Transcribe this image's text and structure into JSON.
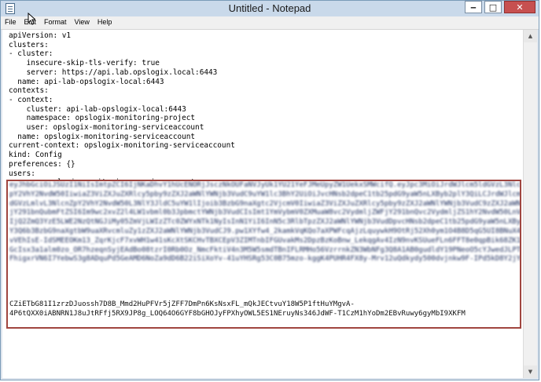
{
  "window": {
    "title": "Untitled - Notepad"
  },
  "controls": {
    "minimize": "‒",
    "maximize": "□",
    "close": "✕"
  },
  "menu": [
    "File",
    "Edit",
    "Format",
    "View",
    "Help"
  ],
  "editor": {
    "config_text": "apiVersion: v1\nclusters:\n- cluster:\n    insecure-skip-tls-verify: true\n    server: https://api.lab.opslogix.local:6443\n  name: api-lab-opslogix-local:6443\ncontexts:\n- context:\n    cluster: api-lab-opslogix-local:6443\n    namespace: opslogix-monitoring-project\n    user: opslogix-monitoring-serviceaccount\n  name: opslogix-monitoring-serviceaccount\ncurrent-context: opslogix-monitoring-serviceaccount\nkind: Config\npreferences: {}\nusers:\n- name: opslogix-monitoring-serviceaccount\n  user:\n    token:",
    "token_lines_visible": [
      "eyJhbGciOiJSUzI1NiIsImtpZCI6IjNKaDhvY1hUcENORjJsczNkOUFaNVJyUk1YU21YeFJMeUpyZW1UekxSMWcifQ.eyJpc3MiOiJrdWJlcm5ldGVzL3NlcnZ",
      "pY2VhY2NvdW50IiwiaZ3ViZXJuZXRlcy5pby9zZXJ2aWNlYWNjb3VudC9uYW1lc3BhY2UiOiJvcHNsb2dpeC1tb25pdG9yaW5nLXByb2plY3QiLCJrdWJlcm5l",
      "dGVzLmlvL3NlcnZpY2VhY2NvdW50L3NlY3JldC5uYW1lIjoib3BzbG9naXgtc2VjcmV0IiwiaZ3ViZXJuZXRlcy5pby9zZXJ2aWNlYWNjb3VudC9zZXJ2aWNlLWF",
      "jY291bnQubmFtZSI6Im9wc2xvZ2l4LW1vbml0b3JpbmctYWNjb3VudCIsImt1YmVybmV0ZXMuaW8vc2VydmljZWFjY291bnQvc2VydmljZS1hY2NvdW50LnVpZCI6",
      "IjQ2ZmQ3YzE5LWE2NzQtNGJiMy05ZmVjLWIzZTc0ZWYxNTk1NyIsInN1YiI6InN5c3RlbTpzZXJ2aWNlYWNjb3VudDpvcHNsb2dpeC1tb25pdG9yaW5nLXByb2pl",
      "Y3Q6b3BzbG9naXgtbW9uaXRvcmluZy1zZXJ2aWNlYWNjb3VudCJ9.pw1XYfw4_2kamkVqKQo7aXPWFcqAjzLquywkH9OtRj52Xh0ym1O4B8D5qG5UI8BNuX4c",
      "vVEhIsE-IdSMEEOKm13_ZqrKjcF7xvWH1w41sKcXtSKCHvTBXCEpV3ZIMTnbIFGUvakMs2DpzBzKoBnw_LekqgAv4IzN9nvKSUueFLn6FFT8e0qpBik68ZK176fB",
      "GcIsx3a1alm0zo_OR7hzeqnSyjEAdBo08tzrI0Rb0Oz_NmcFktiV4n3M5W5smdTBnIFLRMHo56VzrrnkZN3WbNFg3Q8A1AB0gudldY19PNeoO5cYJwedJLPT9ZADkt",
      "FhigxrVN6I7YebwS3g8ADquPd5GeAMD6NoZa9dD6B22iSiXoYv-41uYHSRg53C0B75mzo-kggK4PUHR4FX8y-Mrv12uQdkydy500dvjnkw9F-IPd5kD8Y2jYpdNy"
    ],
    "token_lines_clear": [
      "CZiETbG81I1zrzDJuossh7D8B_Mmd2HuPFVr5jZFF7DmPn6KsNsxFL_mQkJECtvuY18W5P1ftHuYMgvA-",
      "4P6tQXX0iABNRN1J8uJtRFfj5RX9JP8g_LOQ64O6GYF8bGHOJyFPXhyOWL5ES1NEruyNs346JdWF-T1CzM1hYoDm2EBvRuwy6gyMbI9XKFM"
    ]
  }
}
